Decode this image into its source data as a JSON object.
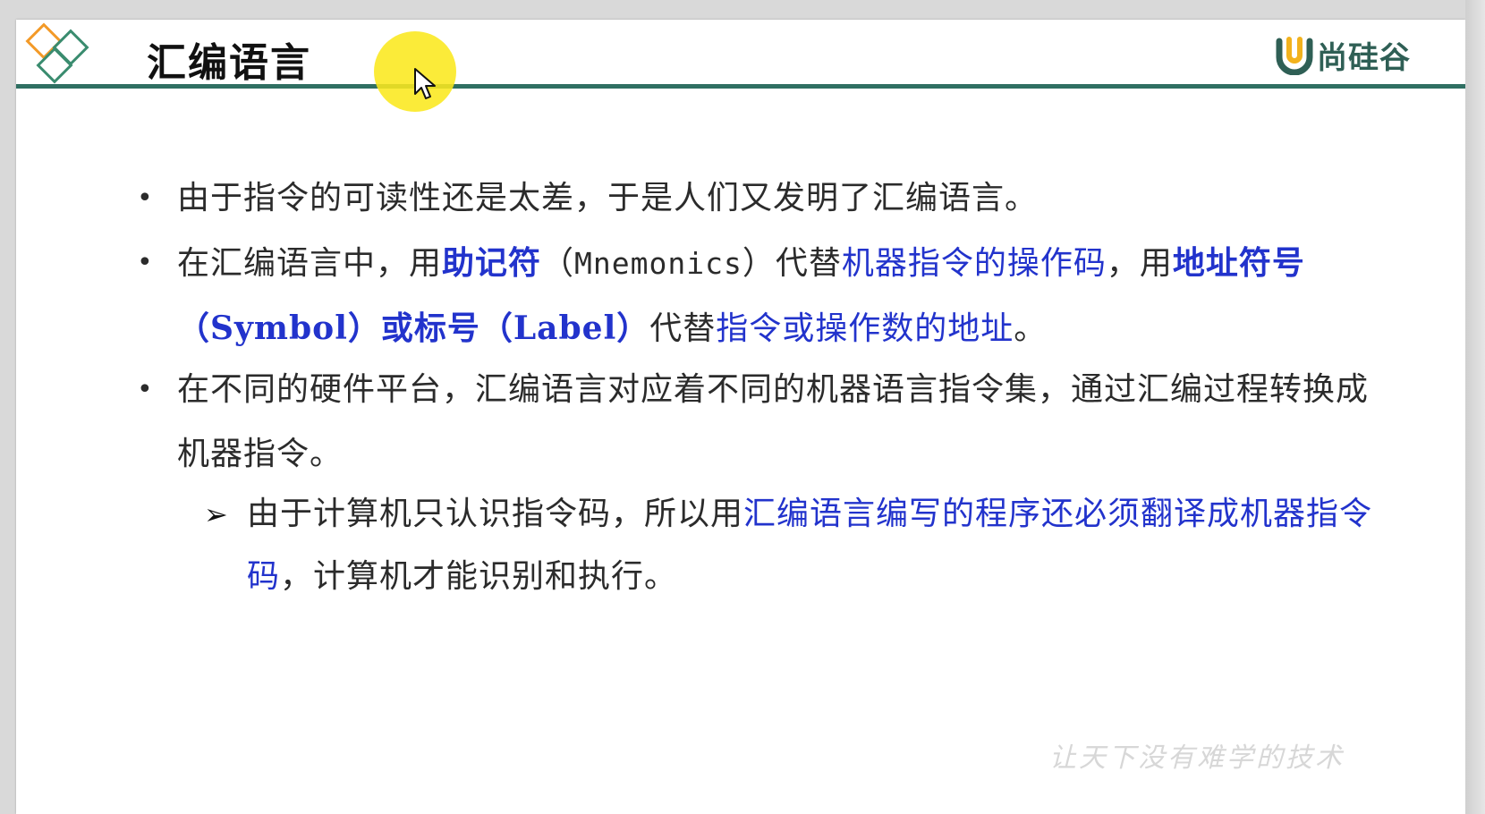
{
  "header": {
    "title": "汇编语言",
    "brand_name": "尚硅谷",
    "brand_color": "#2f5f55",
    "accent_line_color": "#2f6f62"
  },
  "bullets": [
    {
      "marker": "•",
      "parts": [
        {
          "text": "由于指令的可读性还是太差，于是人们又发明了汇编语言。",
          "style": "normal"
        }
      ]
    },
    {
      "marker": "•",
      "parts": [
        {
          "text": "在汇编语言中，用",
          "style": "normal"
        },
        {
          "text": "助记符",
          "style": "hlb"
        },
        {
          "text": "（",
          "style": "normal"
        },
        {
          "text": "Mnemonics",
          "style": "mono"
        },
        {
          "text": "）代替",
          "style": "normal"
        },
        {
          "text": "机器指令的操作码",
          "style": "hl"
        },
        {
          "text": "，用",
          "style": "normal"
        },
        {
          "text": "地址符号（Symbol）或标号（Label）",
          "style": "hlb"
        },
        {
          "text": "代替",
          "style": "normal"
        },
        {
          "text": "指令或操作数的地址",
          "style": "hl"
        },
        {
          "text": "。",
          "style": "normal"
        }
      ]
    },
    {
      "marker": "•",
      "parts": [
        {
          "text": "在不同的硬件平台，汇编语言对应着不同的机器语言指令集，通过汇编过程转换成机器指令。",
          "style": "normal"
        }
      ]
    }
  ],
  "sub_bullets": [
    {
      "marker": "➢",
      "parts": [
        {
          "text": "由于计算机只认识指令码，所以用",
          "style": "normal"
        },
        {
          "text": "汇编语言编写的程序还必须翻译成机器指令码",
          "style": "hl"
        },
        {
          "text": "，计算机才能识别和执行。",
          "style": "normal"
        }
      ]
    }
  ],
  "watermark": "让天下没有难学的技术",
  "colors": {
    "highlight": "#2233cc",
    "text": "#2b2b2b",
    "cursor_halo": "#fae81e"
  },
  "icons": [
    "diamond-logo-icon",
    "brand-u-icon",
    "mouse-pointer-icon"
  ]
}
